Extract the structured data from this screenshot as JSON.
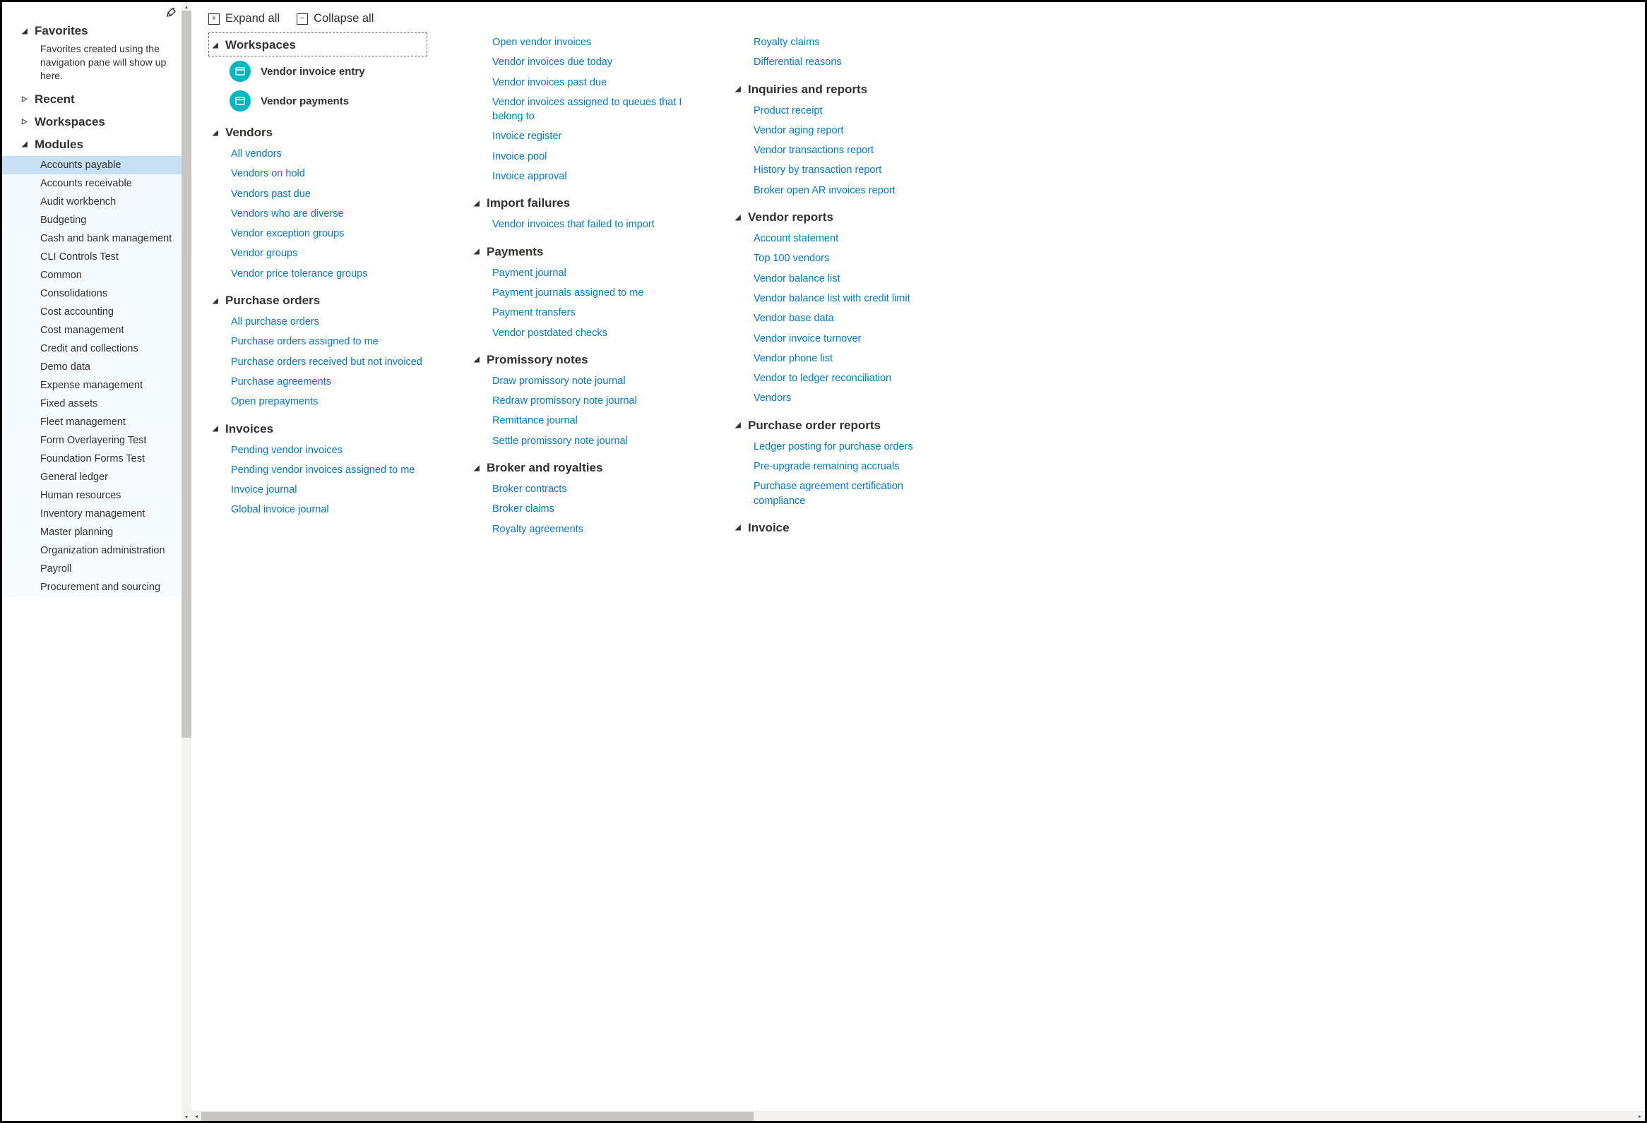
{
  "sidebar": {
    "favorites_label": "Favorites",
    "favorites_desc": "Favorites created using the navigation pane will show up here.",
    "recent_label": "Recent",
    "workspaces_label": "Workspaces",
    "modules_label": "Modules",
    "modules": [
      "Accounts payable",
      "Accounts receivable",
      "Audit workbench",
      "Budgeting",
      "Cash and bank management",
      "CLI Controls Test",
      "Common",
      "Consolidations",
      "Cost accounting",
      "Cost management",
      "Credit and collections",
      "Demo data",
      "Expense management",
      "Fixed assets",
      "Fleet management",
      "Form Overlayering Test",
      "Foundation Forms Test",
      "General ledger",
      "Human resources",
      "Inventory management",
      "Master planning",
      "Organization administration",
      "Payroll",
      "Procurement and sourcing"
    ],
    "active_module_index": 0
  },
  "toolbar": {
    "expand_label": "Expand all",
    "collapse_label": "Collapse all"
  },
  "content": {
    "col1": [
      {
        "title": "Workspaces",
        "selected": true,
        "workspaces": [
          {
            "label": "Vendor invoice entry",
            "icon": "invoice"
          },
          {
            "label": "Vendor payments",
            "icon": "payments"
          }
        ]
      },
      {
        "title": "Vendors",
        "links": [
          "All vendors",
          "Vendors on hold",
          "Vendors past due",
          "Vendors who are diverse",
          "Vendor exception groups",
          "Vendor groups",
          "Vendor price tolerance groups"
        ]
      },
      {
        "title": "Purchase orders",
        "links": [
          "All purchase orders",
          "Purchase orders assigned to me",
          "Purchase orders received but not invoiced",
          "Purchase agreements",
          "Open prepayments"
        ]
      },
      {
        "title": "Invoices",
        "links": [
          "Pending vendor invoices",
          "Pending vendor invoices assigned to me",
          "Invoice journal",
          "Global invoice journal"
        ]
      }
    ],
    "col2": [
      {
        "title": null,
        "links": [
          "Open vendor invoices",
          "Vendor invoices due today",
          "Vendor invoices past due",
          "Vendor invoices assigned to queues that I belong to",
          "Invoice register",
          "Invoice pool",
          "Invoice approval"
        ]
      },
      {
        "title": "Import failures",
        "links": [
          "Vendor invoices that failed to import"
        ]
      },
      {
        "title": "Payments",
        "links": [
          "Payment journal",
          "Payment journals assigned to me",
          "Payment transfers",
          "Vendor postdated checks"
        ]
      },
      {
        "title": "Promissory notes",
        "links": [
          "Draw promissory note journal",
          "Redraw promissory note journal",
          "Remittance journal",
          "Settle promissory note journal"
        ]
      },
      {
        "title": "Broker and royalties",
        "links": [
          "Broker contracts",
          "Broker claims",
          "Royalty agreements"
        ]
      }
    ],
    "col3": [
      {
        "title": null,
        "links": [
          "Royalty claims",
          "Differential reasons"
        ]
      },
      {
        "title": "Inquiries and reports",
        "links": [
          "Product receipt",
          "Vendor aging report",
          "Vendor transactions report",
          "History by transaction report",
          "Broker open AR invoices report"
        ]
      },
      {
        "title": "Vendor reports",
        "links": [
          "Account statement",
          "Top 100 vendors",
          "Vendor balance list",
          "Vendor balance list with credit limit",
          "Vendor base data",
          "Vendor invoice turnover",
          "Vendor phone list",
          "Vendor to ledger reconciliation",
          "Vendors"
        ]
      },
      {
        "title": "Purchase order reports",
        "links": [
          "Ledger posting for purchase orders",
          "Pre-upgrade remaining accruals",
          "Purchase agreement certification compliance"
        ]
      },
      {
        "title": "Invoice",
        "links": []
      }
    ]
  }
}
